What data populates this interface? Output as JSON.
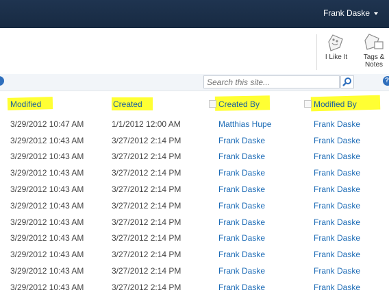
{
  "topbar": {
    "user_name": "Frank Daske"
  },
  "ribbon": {
    "like_label": "I Like It",
    "tags_label_line1": "Tags &",
    "tags_label_line2": "Notes"
  },
  "search": {
    "placeholder": "Search this site...",
    "help_glyph": "?"
  },
  "columns": [
    "Modified",
    "Created",
    "Created By",
    "Modified By"
  ],
  "rows": [
    {
      "modified": "3/29/2012 10:47 AM",
      "created": "1/1/2012 12:00 AM",
      "created_by": "Matthias Hupe",
      "modified_by": "Frank Daske"
    },
    {
      "modified": "3/29/2012 10:43 AM",
      "created": "3/27/2012 2:14 PM",
      "created_by": "Frank Daske",
      "modified_by": "Frank Daske"
    },
    {
      "modified": "3/29/2012 10:43 AM",
      "created": "3/27/2012 2:14 PM",
      "created_by": "Frank Daske",
      "modified_by": "Frank Daske"
    },
    {
      "modified": "3/29/2012 10:43 AM",
      "created": "3/27/2012 2:14 PM",
      "created_by": "Frank Daske",
      "modified_by": "Frank Daske"
    },
    {
      "modified": "3/29/2012 10:43 AM",
      "created": "3/27/2012 2:14 PM",
      "created_by": "Frank Daske",
      "modified_by": "Frank Daske"
    },
    {
      "modified": "3/29/2012 10:43 AM",
      "created": "3/27/2012 2:14 PM",
      "created_by": "Frank Daske",
      "modified_by": "Frank Daske"
    },
    {
      "modified": "3/29/2012 10:43 AM",
      "created": "3/27/2012 2:14 PM",
      "created_by": "Frank Daske",
      "modified_by": "Frank Daske"
    },
    {
      "modified": "3/29/2012 10:43 AM",
      "created": "3/27/2012 2:14 PM",
      "created_by": "Frank Daske",
      "modified_by": "Frank Daske"
    },
    {
      "modified": "3/29/2012 10:43 AM",
      "created": "3/27/2012 2:14 PM",
      "created_by": "Frank Daske",
      "modified_by": "Frank Daske"
    },
    {
      "modified": "3/29/2012 10:43 AM",
      "created": "3/27/2012 2:14 PM",
      "created_by": "Frank Daske",
      "modified_by": "Frank Daske"
    },
    {
      "modified": "3/29/2012 10:43 AM",
      "created": "3/27/2012 2:14 PM",
      "created_by": "Frank Daske",
      "modified_by": "Frank Daske"
    }
  ],
  "colors": {
    "topbar": "#1f3450",
    "link": "#1a6ab5",
    "highlight": "#ffff33"
  }
}
